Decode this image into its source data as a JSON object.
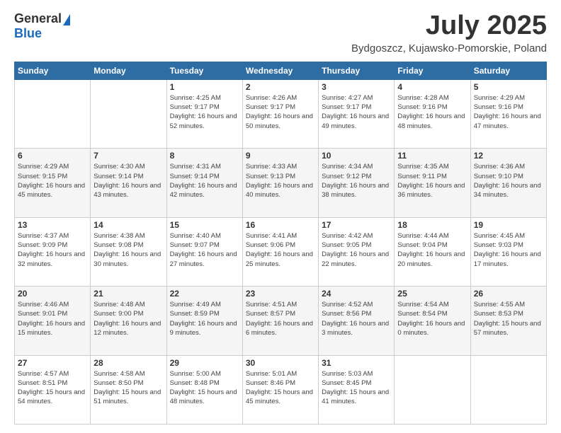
{
  "logo": {
    "general": "General",
    "blue": "Blue"
  },
  "title": "July 2025",
  "subtitle": "Bydgoszcz, Kujawsko-Pomorskie, Poland",
  "days_of_week": [
    "Sunday",
    "Monday",
    "Tuesday",
    "Wednesday",
    "Thursday",
    "Friday",
    "Saturday"
  ],
  "weeks": [
    [
      {
        "day": "",
        "sunrise": "",
        "sunset": "",
        "daylight": ""
      },
      {
        "day": "",
        "sunrise": "",
        "sunset": "",
        "daylight": ""
      },
      {
        "day": "1",
        "sunrise": "Sunrise: 4:25 AM",
        "sunset": "Sunset: 9:17 PM",
        "daylight": "Daylight: 16 hours and 52 minutes."
      },
      {
        "day": "2",
        "sunrise": "Sunrise: 4:26 AM",
        "sunset": "Sunset: 9:17 PM",
        "daylight": "Daylight: 16 hours and 50 minutes."
      },
      {
        "day": "3",
        "sunrise": "Sunrise: 4:27 AM",
        "sunset": "Sunset: 9:17 PM",
        "daylight": "Daylight: 16 hours and 49 minutes."
      },
      {
        "day": "4",
        "sunrise": "Sunrise: 4:28 AM",
        "sunset": "Sunset: 9:16 PM",
        "daylight": "Daylight: 16 hours and 48 minutes."
      },
      {
        "day": "5",
        "sunrise": "Sunrise: 4:29 AM",
        "sunset": "Sunset: 9:16 PM",
        "daylight": "Daylight: 16 hours and 47 minutes."
      }
    ],
    [
      {
        "day": "6",
        "sunrise": "Sunrise: 4:29 AM",
        "sunset": "Sunset: 9:15 PM",
        "daylight": "Daylight: 16 hours and 45 minutes."
      },
      {
        "day": "7",
        "sunrise": "Sunrise: 4:30 AM",
        "sunset": "Sunset: 9:14 PM",
        "daylight": "Daylight: 16 hours and 43 minutes."
      },
      {
        "day": "8",
        "sunrise": "Sunrise: 4:31 AM",
        "sunset": "Sunset: 9:14 PM",
        "daylight": "Daylight: 16 hours and 42 minutes."
      },
      {
        "day": "9",
        "sunrise": "Sunrise: 4:33 AM",
        "sunset": "Sunset: 9:13 PM",
        "daylight": "Daylight: 16 hours and 40 minutes."
      },
      {
        "day": "10",
        "sunrise": "Sunrise: 4:34 AM",
        "sunset": "Sunset: 9:12 PM",
        "daylight": "Daylight: 16 hours and 38 minutes."
      },
      {
        "day": "11",
        "sunrise": "Sunrise: 4:35 AM",
        "sunset": "Sunset: 9:11 PM",
        "daylight": "Daylight: 16 hours and 36 minutes."
      },
      {
        "day": "12",
        "sunrise": "Sunrise: 4:36 AM",
        "sunset": "Sunset: 9:10 PM",
        "daylight": "Daylight: 16 hours and 34 minutes."
      }
    ],
    [
      {
        "day": "13",
        "sunrise": "Sunrise: 4:37 AM",
        "sunset": "Sunset: 9:09 PM",
        "daylight": "Daylight: 16 hours and 32 minutes."
      },
      {
        "day": "14",
        "sunrise": "Sunrise: 4:38 AM",
        "sunset": "Sunset: 9:08 PM",
        "daylight": "Daylight: 16 hours and 30 minutes."
      },
      {
        "day": "15",
        "sunrise": "Sunrise: 4:40 AM",
        "sunset": "Sunset: 9:07 PM",
        "daylight": "Daylight: 16 hours and 27 minutes."
      },
      {
        "day": "16",
        "sunrise": "Sunrise: 4:41 AM",
        "sunset": "Sunset: 9:06 PM",
        "daylight": "Daylight: 16 hours and 25 minutes."
      },
      {
        "day": "17",
        "sunrise": "Sunrise: 4:42 AM",
        "sunset": "Sunset: 9:05 PM",
        "daylight": "Daylight: 16 hours and 22 minutes."
      },
      {
        "day": "18",
        "sunrise": "Sunrise: 4:44 AM",
        "sunset": "Sunset: 9:04 PM",
        "daylight": "Daylight: 16 hours and 20 minutes."
      },
      {
        "day": "19",
        "sunrise": "Sunrise: 4:45 AM",
        "sunset": "Sunset: 9:03 PM",
        "daylight": "Daylight: 16 hours and 17 minutes."
      }
    ],
    [
      {
        "day": "20",
        "sunrise": "Sunrise: 4:46 AM",
        "sunset": "Sunset: 9:01 PM",
        "daylight": "Daylight: 16 hours and 15 minutes."
      },
      {
        "day": "21",
        "sunrise": "Sunrise: 4:48 AM",
        "sunset": "Sunset: 9:00 PM",
        "daylight": "Daylight: 16 hours and 12 minutes."
      },
      {
        "day": "22",
        "sunrise": "Sunrise: 4:49 AM",
        "sunset": "Sunset: 8:59 PM",
        "daylight": "Daylight: 16 hours and 9 minutes."
      },
      {
        "day": "23",
        "sunrise": "Sunrise: 4:51 AM",
        "sunset": "Sunset: 8:57 PM",
        "daylight": "Daylight: 16 hours and 6 minutes."
      },
      {
        "day": "24",
        "sunrise": "Sunrise: 4:52 AM",
        "sunset": "Sunset: 8:56 PM",
        "daylight": "Daylight: 16 hours and 3 minutes."
      },
      {
        "day": "25",
        "sunrise": "Sunrise: 4:54 AM",
        "sunset": "Sunset: 8:54 PM",
        "daylight": "Daylight: 16 hours and 0 minutes."
      },
      {
        "day": "26",
        "sunrise": "Sunrise: 4:55 AM",
        "sunset": "Sunset: 8:53 PM",
        "daylight": "Daylight: 15 hours and 57 minutes."
      }
    ],
    [
      {
        "day": "27",
        "sunrise": "Sunrise: 4:57 AM",
        "sunset": "Sunset: 8:51 PM",
        "daylight": "Daylight: 15 hours and 54 minutes."
      },
      {
        "day": "28",
        "sunrise": "Sunrise: 4:58 AM",
        "sunset": "Sunset: 8:50 PM",
        "daylight": "Daylight: 15 hours and 51 minutes."
      },
      {
        "day": "29",
        "sunrise": "Sunrise: 5:00 AM",
        "sunset": "Sunset: 8:48 PM",
        "daylight": "Daylight: 15 hours and 48 minutes."
      },
      {
        "day": "30",
        "sunrise": "Sunrise: 5:01 AM",
        "sunset": "Sunset: 8:46 PM",
        "daylight": "Daylight: 15 hours and 45 minutes."
      },
      {
        "day": "31",
        "sunrise": "Sunrise: 5:03 AM",
        "sunset": "Sunset: 8:45 PM",
        "daylight": "Daylight: 15 hours and 41 minutes."
      },
      {
        "day": "",
        "sunrise": "",
        "sunset": "",
        "daylight": ""
      },
      {
        "day": "",
        "sunrise": "",
        "sunset": "",
        "daylight": ""
      }
    ]
  ]
}
